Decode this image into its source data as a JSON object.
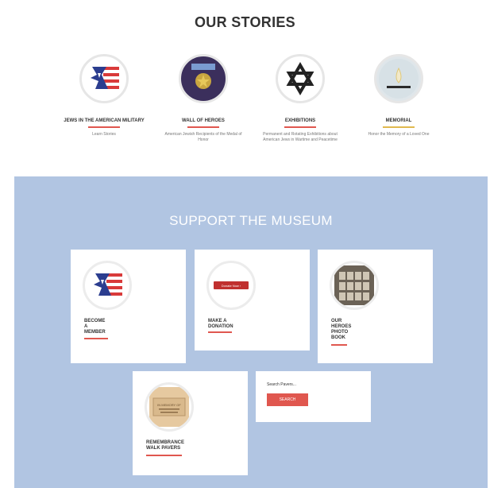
{
  "stories": {
    "title": "OUR STORIES",
    "items": [
      {
        "title": "Jews in the American Military",
        "description": "Learn Stories",
        "icon": "flag-star-emblem-icon"
      },
      {
        "title": "Wall of Heroes",
        "description": "American Jewish Recipients of the Medal of Honor",
        "icon": "medal-of-honor-icon"
      },
      {
        "title": "Exhibitions",
        "description": "Permanent and Rotating Exhibitions about American Jews in Wartime and Peacetime",
        "icon": "star-of-david-icon"
      },
      {
        "title": "Memorial",
        "description": "Honor the Memory of a Loved One",
        "icon": "memorial-flame-icon"
      }
    ]
  },
  "support": {
    "title": "SUPPORT THE MUSEUM",
    "cards": [
      {
        "label": "BECOME\nA\nMEMBER",
        "icon": "flag-star-emblem-icon"
      },
      {
        "label": "MAKE A\nDONATION",
        "icon": "donate-button-icon",
        "button_label": "Donate Now ›"
      },
      {
        "label": "OUR\nHEROES\nPHOTO\nBOOK",
        "icon": "photo-book-icon"
      },
      {
        "label": "REMEMBRANCE\nWALK PAVERS",
        "icon": "paver-brick-icon",
        "paver_text": "IN MEMORY OF"
      }
    ],
    "search": {
      "label": "Search Pavers...",
      "button_label": "SEARCH"
    }
  },
  "colors": {
    "accent": "#e0574f",
    "support_bg": "#b1c5e2",
    "flag_blue": "#2b3d8f",
    "flag_red": "#d93a3a"
  }
}
